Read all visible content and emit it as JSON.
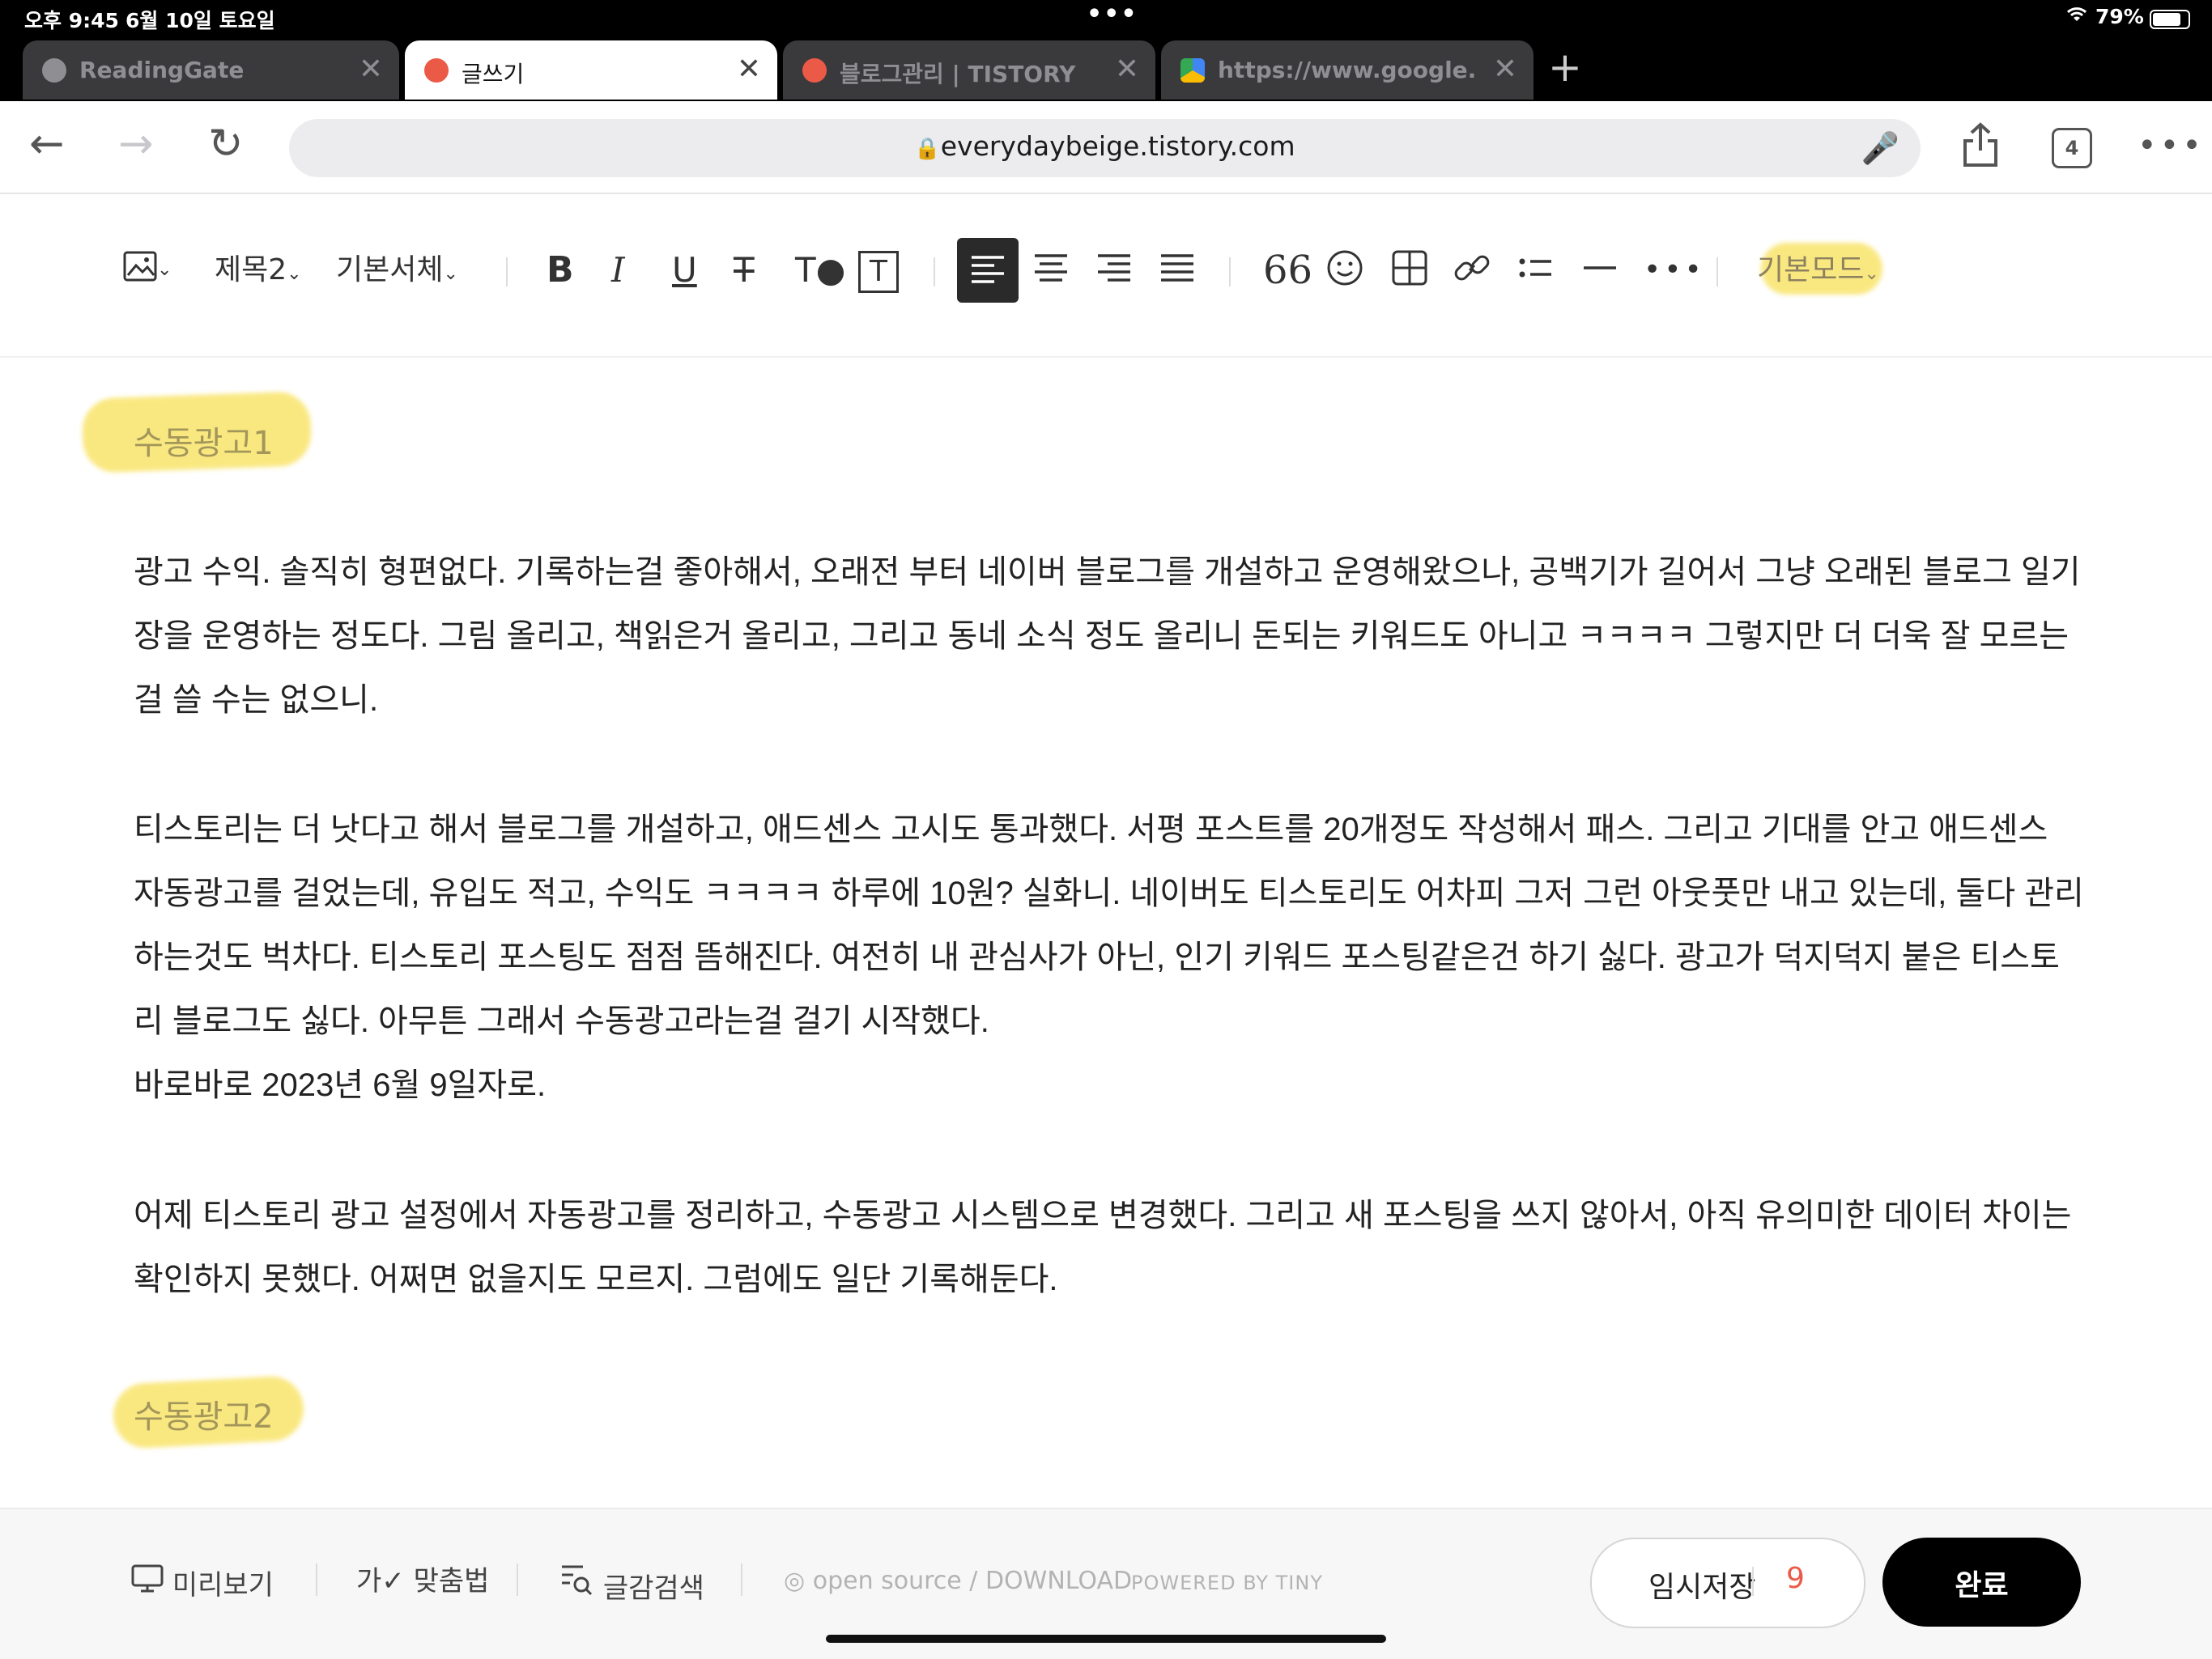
{
  "status": {
    "time": "오후 9:45",
    "date": "6월 10일 토요일",
    "battery": "79%"
  },
  "tabs": [
    {
      "title": "ReadingGate",
      "active": false
    },
    {
      "title": "글쓰기",
      "active": true
    },
    {
      "title": "블로그관리 | TISTORY",
      "active": false
    },
    {
      "title": "https://www.google.com",
      "active": false
    }
  ],
  "nav": {
    "url": "everydaybeige.tistory.com",
    "tab_count": "4"
  },
  "toolbar": {
    "heading": "제목2",
    "font": "기본서체",
    "mode": "기본모드"
  },
  "content": {
    "section1": "수동광고1",
    "para1": "광고 수익. 솔직히 형편없다. 기록하는걸 좋아해서, 오래전 부터 네이버 블로그를 개설하고 운영해왔으나, 공백기가 길어서 그냥 오래된 블로그 일기장을 운영하는 정도다. 그림 올리고, 책읽은거 올리고, 그리고 동네 소식 정도 올리니 돈되는 키워드도 아니고 ㅋㅋㅋㅋ 그렇지만 더 더욱 잘 모르는걸 쓸 수는 없으니.",
    "para2": "티스토리는 더 낫다고 해서 블로그를 개설하고, 애드센스 고시도 통과했다. 서평 포스트를 20개정도 작성해서 패스. 그리고 기대를 안고 애드센스 자동광고를 걸었는데, 유입도 적고, 수익도 ㅋㅋㅋㅋ 하루에 10원? 실화니. 네이버도 티스토리도 어차피 그저 그런 아웃풋만 내고 있는데, 둘다 관리 하는것도 벅차다. 티스토리 포스팅도 점점 뜸해진다. 여전히 내 관심사가 아닌, 인기 키워드 포스팅같은건 하기 싫다. 광고가 덕지덕지 붙은 티스토리 블로그도 싫다. 아무튼 그래서 수동광고라는걸 걸기 시작했다.",
    "para2b": "바로바로 2023년 6월 9일자로.",
    "para3": "어제 티스토리 광고 설정에서 자동광고를 정리하고, 수동광고 시스템으로 변경했다. 그리고 새 포스팅을 쓰지 않아서, 아직 유의미한 데이터 차이는 확인하지 못했다. 어쩌면 없을지도 모르지. 그럼에도 일단 기록해둔다.",
    "section2": "수동광고2"
  },
  "bottom": {
    "preview": "미리보기",
    "spell": "맞춤법",
    "search": "글감검색",
    "opensource": "open source / DOWNLOAD",
    "powered": "POWERED BY TINY",
    "draft_label": "임시저장",
    "draft_count": "9",
    "done": "완료"
  },
  "colors": {
    "highlight": "#f9e46a",
    "tistory_red": "#eb5a46",
    "done_bg": "#000000"
  }
}
